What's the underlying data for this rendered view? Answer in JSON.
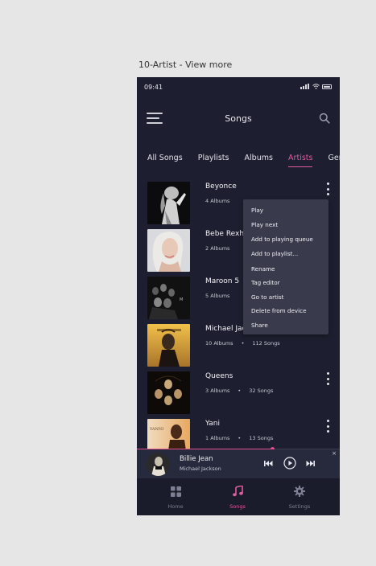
{
  "frame_label": "10-Artist - View more",
  "status_bar": {
    "time": "09:41"
  },
  "header": {
    "title": "Songs"
  },
  "tabs": [
    {
      "label": "All Songs"
    },
    {
      "label": "Playlists"
    },
    {
      "label": "Albums"
    },
    {
      "label": "Artists",
      "active": true
    },
    {
      "label": "Genre"
    }
  ],
  "artists": [
    {
      "name": "Beyonce",
      "albums": "4 Albums",
      "songs": ""
    },
    {
      "name": "Bebe Rexha",
      "albums": "2 Albums",
      "songs": ""
    },
    {
      "name": "Maroon 5",
      "albums": "5 Albums",
      "songs": ""
    },
    {
      "name": "Michael Jackson",
      "albums": "10 Albums",
      "songs": "112 Songs"
    },
    {
      "name": "Queens",
      "albums": "3 Albums",
      "songs": "32 Songs"
    },
    {
      "name": "Yani",
      "albums": "1 Albums",
      "songs": "13 Songs"
    }
  ],
  "context_menu": {
    "items": [
      "Play",
      "Play next",
      "Add to playing queue",
      "Add to playlist...",
      "Rename",
      "Tag editor",
      "Go to artist",
      "Delete from device",
      "Share"
    ]
  },
  "now_playing": {
    "title": "Billie Jean",
    "artist": "Michael Jackson",
    "progress": 0.67
  },
  "bottom_nav": [
    {
      "label": "Home",
      "icon": "grid-icon"
    },
    {
      "label": "Songs",
      "icon": "music-note-icon",
      "active": true
    },
    {
      "label": "Settings",
      "icon": "gear-icon"
    }
  ],
  "colors": {
    "background": "#1d1f30",
    "accent": "#e05aa0",
    "menu_background": "#393b4d",
    "miniplayer_background": "#272a3d"
  }
}
